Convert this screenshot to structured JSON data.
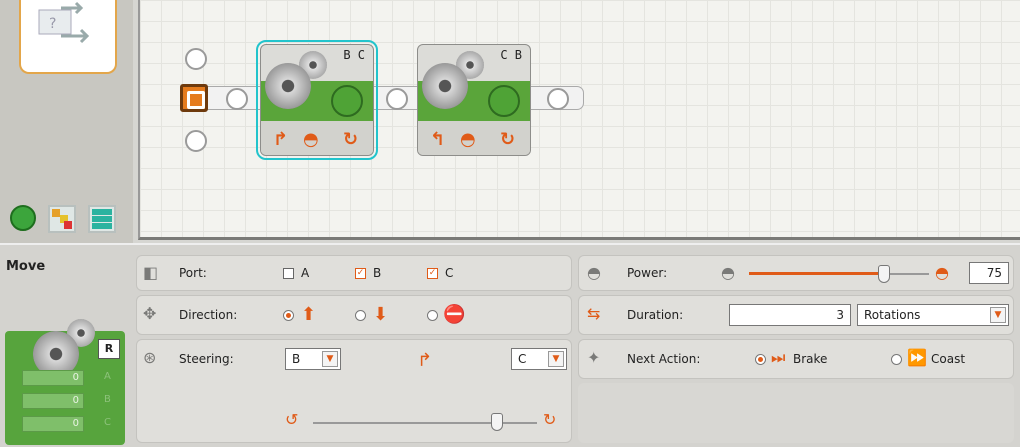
{
  "canvas": {
    "blocks": [
      {
        "ports": "B C",
        "selected": true
      },
      {
        "ports": "C B",
        "selected": false
      }
    ]
  },
  "palette": {
    "tabs": [
      "common-palette",
      "complete-palette",
      "custom-palette"
    ]
  },
  "config": {
    "title": "Move",
    "feedback": {
      "r_label": "R",
      "rows": [
        {
          "value": "0",
          "port": "A"
        },
        {
          "value": "0",
          "port": "B"
        },
        {
          "value": "0",
          "port": "C"
        }
      ]
    },
    "port": {
      "label": "Port:",
      "options": [
        {
          "name": "A",
          "checked": false
        },
        {
          "name": "B",
          "checked": true
        },
        {
          "name": "C",
          "checked": true
        }
      ]
    },
    "direction": {
      "label": "Direction:",
      "selected": "forward",
      "icons": [
        "up-arrow-icon",
        "down-arrow-icon",
        "stop-icon"
      ]
    },
    "steering": {
      "label": "Steering:",
      "left_port": "B",
      "right_port": "C",
      "slider_position": 0.82
    },
    "power": {
      "label": "Power:",
      "value": "75",
      "slider_fraction": 0.75
    },
    "duration": {
      "label": "Duration:",
      "value": "3",
      "unit": "Rotations"
    },
    "next_action": {
      "label": "Next Action:",
      "options": [
        "Brake",
        "Coast"
      ],
      "selected": "Brake"
    }
  }
}
